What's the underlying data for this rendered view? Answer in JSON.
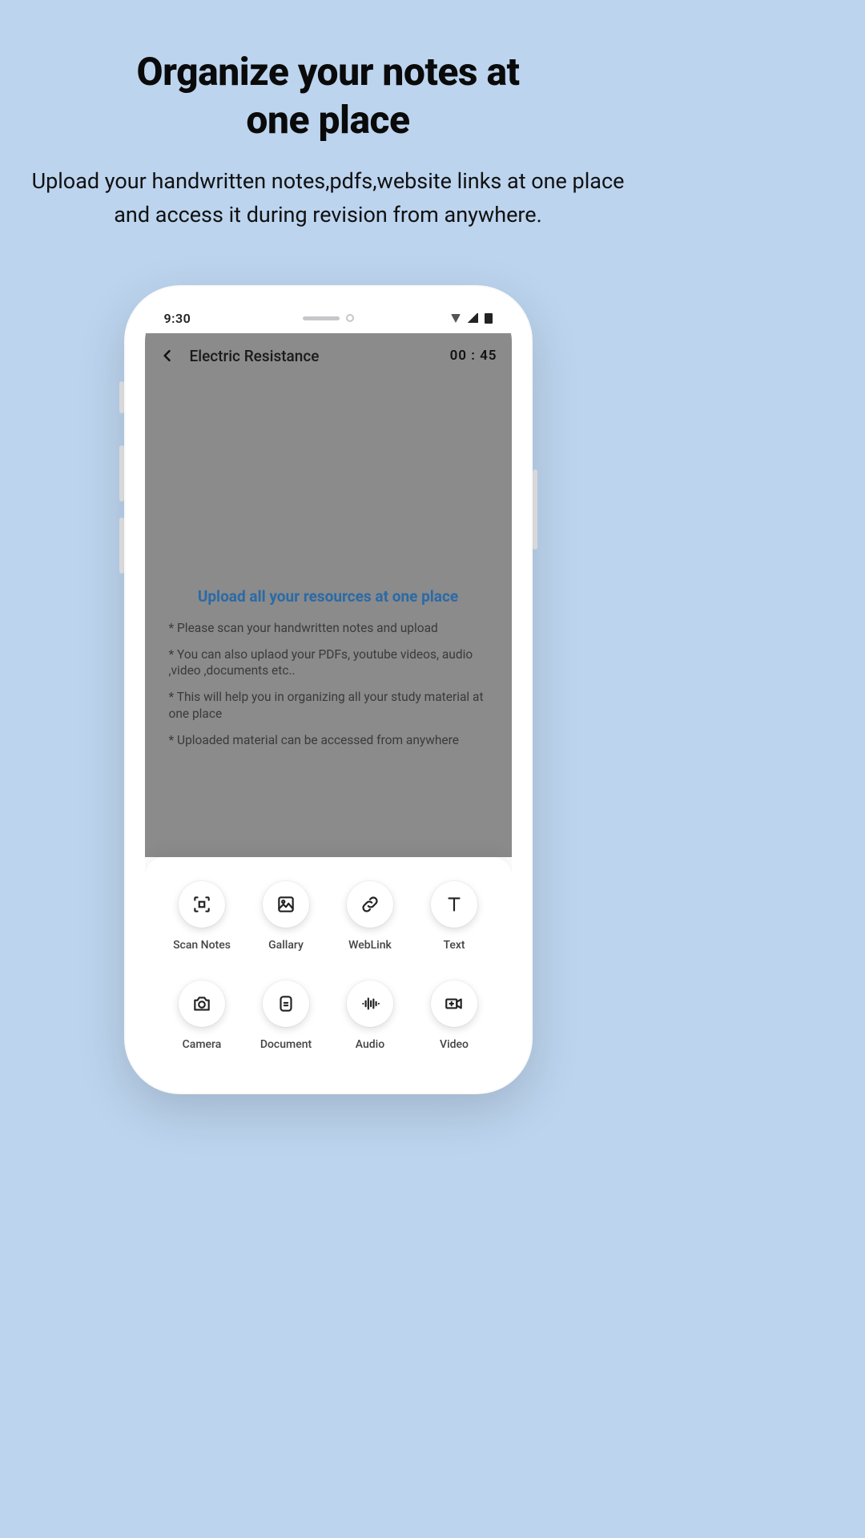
{
  "hero": {
    "title_line1": "Organize your notes at",
    "title_line2": "one place",
    "subtitle": "Upload your handwritten notes,pdfs,website links at one place and access it during revision from anywhere."
  },
  "statusbar": {
    "time": "9:30"
  },
  "app": {
    "header": {
      "title": "Electric Resistance",
      "timer": "00 : 45"
    },
    "center": {
      "title": "Upload all your resources at one place",
      "bullets": [
        "* Please scan your handwritten notes and upload",
        "* You can also uplaod your PDFs, youtube videos, audio ,video ,documents etc..",
        "* This will help you in organizing all your study material at one place",
        "* Uploaded material can be accessed from anywhere"
      ]
    },
    "sheet": {
      "options": [
        {
          "label": "Scan Notes"
        },
        {
          "label": "Gallary"
        },
        {
          "label": "WebLink"
        },
        {
          "label": "Text"
        },
        {
          "label": "Camera"
        },
        {
          "label": "Document"
        },
        {
          "label": "Audio"
        },
        {
          "label": "Video"
        }
      ]
    }
  }
}
